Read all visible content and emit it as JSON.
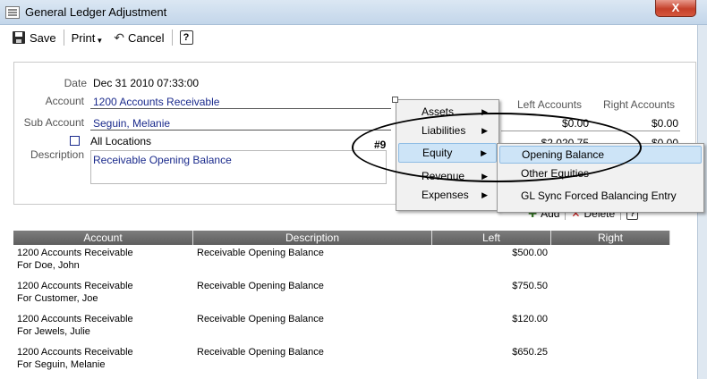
{
  "window": {
    "title": "General Ledger Adjustment",
    "close_glyph": "X"
  },
  "toolbar": {
    "save_label": "Save",
    "print_label": "Print",
    "cancel_label": "Cancel",
    "help_glyph": "?"
  },
  "form": {
    "date_label": "Date",
    "date_value": "Dec 31 2010 07:33:00",
    "account_label": "Account",
    "account_value": "1200 Accounts Receivable",
    "sub_account_label": "Sub Account",
    "sub_account_value": "Seguin, Melanie",
    "all_locations_label": "All Locations",
    "description_label": "Description",
    "description_value": "Receivable Opening Balance",
    "entry_number": "#9"
  },
  "summary": {
    "left_header": "Left Accounts",
    "right_header": "Right Accounts",
    "row1_left": "$0.00",
    "row1_right": "$0.00",
    "row2_left": "$2,020.75",
    "row2_right": "$0.00"
  },
  "row_actions": {
    "add_label": "Add",
    "delete_label": "Delete"
  },
  "grid": {
    "columns": [
      "Account",
      "Description",
      "Left",
      "Right"
    ],
    "rows": [
      {
        "account": "1200 Accounts Receivable",
        "for": "For Doe, John",
        "description": "Receivable Opening Balance",
        "left": "$500.00",
        "right": ""
      },
      {
        "account": "1200 Accounts Receivable",
        "for": "For Customer, Joe",
        "description": "Receivable Opening Balance",
        "left": "$750.50",
        "right": ""
      },
      {
        "account": "1200 Accounts Receivable",
        "for": "For Jewels, Julie",
        "description": "Receivable Opening Balance",
        "left": "$120.00",
        "right": ""
      },
      {
        "account": "1200 Accounts Receivable",
        "for": "For Seguin, Melanie",
        "description": "Receivable Opening Balance",
        "left": "$650.25",
        "right": ""
      }
    ]
  },
  "context_menu": {
    "items": [
      "Assets",
      "Liabilities",
      "Equity",
      "Revenue",
      "Expenses"
    ],
    "active": "Equity"
  },
  "submenu": {
    "items": [
      "Opening Balance",
      "Other Equities",
      "GL Sync Forced Balancing Entry"
    ],
    "active": "Opening Balance"
  }
}
